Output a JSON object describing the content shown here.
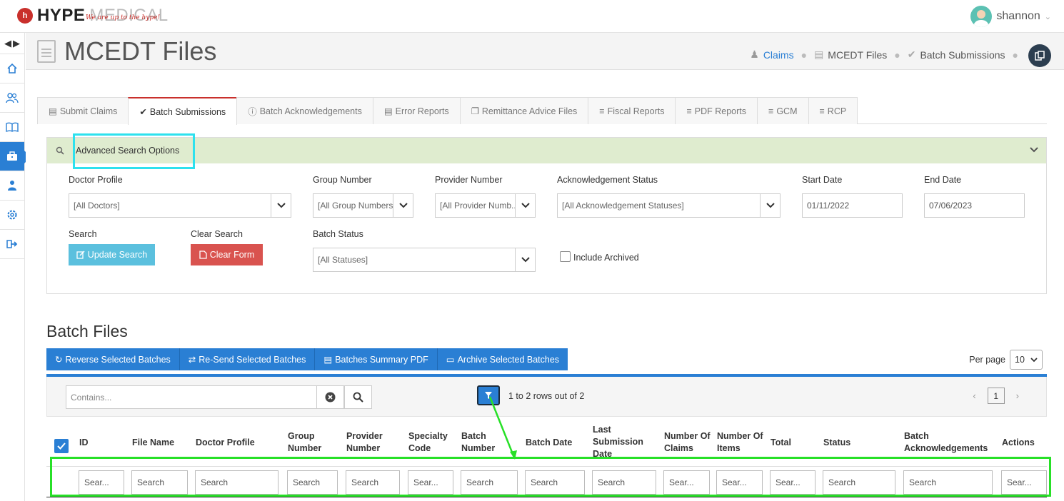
{
  "brand": {
    "name_bold": "HYPE",
    "name_light": "MEDICAL",
    "tagline": "We are up to the hype!",
    "badge": "h"
  },
  "user": {
    "name": "shannon"
  },
  "sidebar": {
    "items": [
      "home",
      "users",
      "book",
      "briefcase",
      "doctor",
      "settings",
      "logout"
    ],
    "active": "briefcase"
  },
  "page": {
    "title": "MCEDT Files"
  },
  "breadcrumb": [
    {
      "label": "Claims",
      "icon": "users-icon"
    },
    {
      "label": "MCEDT Files",
      "icon": "file-icon"
    },
    {
      "label": "Batch Submissions",
      "icon": "check-circle-icon"
    }
  ],
  "tabs": [
    {
      "label": "Submit Claims"
    },
    {
      "label": "Batch Submissions",
      "active": true
    },
    {
      "label": "Batch Acknowledgements"
    },
    {
      "label": "Error Reports"
    },
    {
      "label": "Remittance Advice Files"
    },
    {
      "label": "Fiscal Reports"
    },
    {
      "label": "PDF Reports"
    },
    {
      "label": "GCM"
    },
    {
      "label": "RCP"
    }
  ],
  "search_panel": {
    "title": "Advanced Search Options",
    "doctor_profile": {
      "label": "Doctor Profile",
      "value": "[All Doctors]"
    },
    "group_number": {
      "label": "Group Number",
      "value": "[All Group Numbers]"
    },
    "provider_number": {
      "label": "Provider Number",
      "value": "[All Provider Numb..."
    },
    "ack_status": {
      "label": "Acknowledgement Status",
      "value": "[All Acknowledgement Statuses]"
    },
    "start_date": {
      "label": "Start Date",
      "value": "01/11/2022"
    },
    "end_date": {
      "label": "End Date",
      "value": "07/06/2023"
    },
    "search": {
      "label": "Search",
      "button": "Update Search"
    },
    "clear": {
      "label": "Clear Search",
      "button": "Clear Form"
    },
    "batch_status": {
      "label": "Batch Status",
      "value": "[All Statuses]"
    },
    "include_archived": "Include Archived"
  },
  "batch_files": {
    "title": "Batch Files",
    "actions": [
      "Reverse Selected Batches",
      "Re-Send Selected Batches",
      "Batches Summary PDF",
      "Archive Selected Batches"
    ],
    "per_page_label": "Per page",
    "per_page_value": "10",
    "search_placeholder": "Contains...",
    "row_count": "1 to 2 rows out of 2",
    "current_page": "1",
    "columns": [
      "ID",
      "File Name",
      "Doctor Profile",
      "Group Number",
      "Provider Number",
      "Specialty Code",
      "Batch Number",
      "Batch Date",
      "Last Submission Date",
      "Number Of Claims",
      "Number Of Items",
      "Total",
      "Status",
      "Batch Acknowledgements",
      "Actions"
    ],
    "filter_placeholders": [
      "Sear...",
      "Search",
      "Search",
      "Search",
      "Search",
      "Sear...",
      "Search",
      "Search",
      "Search",
      "Sear...",
      "Sear...",
      "Sear...",
      "Search",
      "Search",
      "Sear..."
    ]
  },
  "colors": {
    "accent": "#2a7fd4",
    "danger": "#d9534f",
    "info": "#5bc0de",
    "panel_head": "#dfeccf",
    "highlight_cyan": "#2de1ee",
    "highlight_green": "#27e027"
  }
}
